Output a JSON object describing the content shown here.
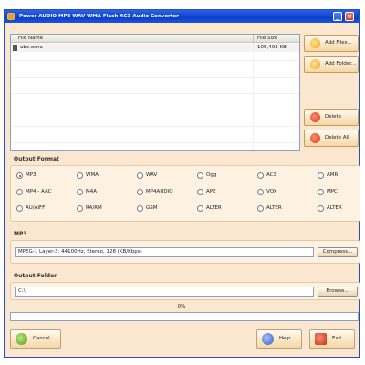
{
  "window": {
    "title": "Power AUDIO MP3 WAV WMA Flash AC3 Audio Converter",
    "minimize_label": "_",
    "close_label": "×"
  },
  "file_list": {
    "col_name": "File Name",
    "col_size": "File Size",
    "rows": [
      {
        "name": "abc.wma",
        "size": "105,493 KB"
      }
    ]
  },
  "side_buttons": {
    "add_files": "Add Files...",
    "add_folder": "Add Folder...",
    "delete": "Delete",
    "delete_all": "Delete All"
  },
  "output_format": {
    "label": "Output Format",
    "selected": "MP3",
    "options": [
      "MP3",
      "WMA",
      "WAV",
      "Ogg",
      "AC3",
      "AMR",
      "MP4 - AAC",
      "M4A",
      "MP4AUDIO",
      "APE",
      "VOX",
      "MPC",
      "AU/AIFF",
      "RA/RM",
      "GSM",
      "ALTER",
      "ALTER",
      "ALTER"
    ]
  },
  "codec": {
    "label": "MP3",
    "value": "MPEG-1 Layer-3: 44100Hz, Stereo, 128 (KB/Kbps)",
    "button": "Compress..."
  },
  "output_folder": {
    "label": "Output Folder",
    "value": "C:\\",
    "button": "Browse..."
  },
  "progress": {
    "label": "0%",
    "value": 0
  },
  "bottom_buttons": {
    "cancel": "Cancel",
    "help": "Help",
    "exit": "Exit"
  }
}
